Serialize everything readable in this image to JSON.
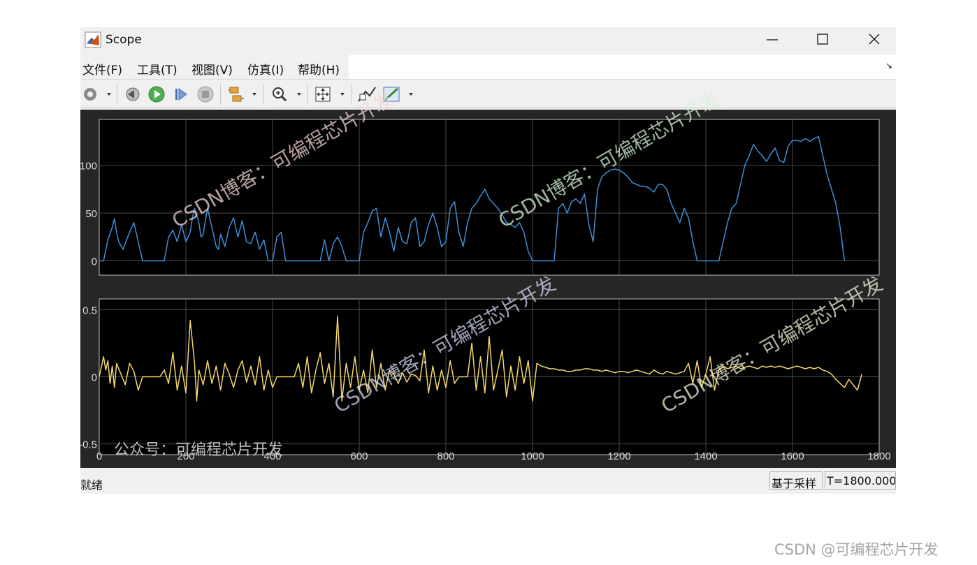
{
  "window": {
    "title": "Scope"
  },
  "menu": [
    "文件(F)",
    "工具(T)",
    "视图(V)",
    "仿真(I)",
    "帮助(H)"
  ],
  "toolbar": {
    "buttons": [
      "gear-icon",
      "step-back-icon",
      "run-icon",
      "step-forward-icon",
      "stop-icon",
      "signal-select-icon",
      "zoom-icon",
      "autoscale-icon",
      "data-cursor-icon",
      "measure-icon"
    ]
  },
  "plots": [
    {
      "line_color": "#3f8fd6",
      "yticks": [
        0,
        50,
        100
      ],
      "ylim": [
        -15,
        148
      ]
    },
    {
      "line_color": "#f5d76b",
      "yticks": [
        -0.5,
        0,
        0.5
      ],
      "ylim": [
        -0.58,
        0.58
      ]
    }
  ],
  "xaxis": {
    "xlim": [
      0,
      1800
    ],
    "ticks": [
      0,
      200,
      400,
      600,
      800,
      1000,
      1200,
      1400,
      1600,
      1800
    ]
  },
  "chart_data": [
    {
      "type": "line",
      "x": [
        0,
        10,
        20,
        30,
        35,
        40,
        45,
        55,
        60,
        70,
        80,
        90,
        100,
        110,
        120,
        130,
        140,
        150,
        160,
        170,
        180,
        190,
        200,
        210,
        215,
        220,
        230,
        235,
        240,
        245,
        250,
        260,
        270,
        275,
        280,
        290,
        300,
        310,
        320,
        330,
        340,
        350,
        360,
        370,
        380,
        390,
        400,
        410,
        420,
        430,
        440,
        450,
        460,
        470,
        480,
        490,
        500,
        510,
        520,
        530,
        540,
        550,
        560,
        570,
        580,
        590,
        600,
        610,
        620,
        630,
        640,
        650,
        660,
        670,
        680,
        690,
        700,
        710,
        720,
        730,
        740,
        750,
        760,
        770,
        780,
        790,
        800,
        810,
        820,
        830,
        840,
        850,
        860,
        870,
        880,
        890,
        900,
        910,
        920,
        930,
        940,
        950,
        960,
        970,
        980,
        990,
        1000,
        1010,
        1020,
        1030,
        1040,
        1050,
        1060,
        1070,
        1080,
        1090,
        1100,
        1110,
        1120,
        1130,
        1140,
        1150,
        1160,
        1170,
        1180,
        1190,
        1200,
        1210,
        1220,
        1230,
        1240,
        1250,
        1260,
        1270,
        1280,
        1290,
        1300,
        1310,
        1320,
        1330,
        1340,
        1350,
        1360,
        1370,
        1380,
        1390,
        1400,
        1410,
        1420,
        1430,
        1440,
        1450,
        1460,
        1470,
        1480,
        1490,
        1500,
        1510,
        1520,
        1530,
        1540,
        1550,
        1560,
        1570,
        1580,
        1590,
        1600,
        1610,
        1620,
        1630,
        1640,
        1650,
        1660,
        1670,
        1680,
        1690,
        1700,
        1710,
        1720,
        1730,
        1740,
        1750,
        1760,
        1770,
        1780,
        1790,
        1800
      ],
      "y": [
        0,
        0,
        22,
        35,
        44,
        30,
        20,
        12,
        18,
        30,
        40,
        20,
        0,
        0,
        0,
        0,
        0,
        0,
        25,
        32,
        20,
        38,
        20,
        30,
        45,
        55,
        40,
        25,
        28,
        42,
        55,
        35,
        15,
        12,
        28,
        15,
        35,
        45,
        25,
        42,
        20,
        18,
        30,
        12,
        22,
        0,
        0,
        25,
        30,
        0,
        0,
        0,
        0,
        0,
        0,
        0,
        0,
        0,
        22,
        0,
        18,
        25,
        15,
        0,
        0,
        0,
        0,
        30,
        40,
        52,
        55,
        25,
        45,
        30,
        10,
        35,
        20,
        18,
        40,
        45,
        15,
        20,
        38,
        50,
        35,
        15,
        20,
        55,
        62,
        30,
        15,
        40,
        55,
        60,
        68,
        75,
        65,
        60,
        55,
        48,
        40,
        38,
        35,
        40,
        30,
        10,
        0,
        0,
        0,
        0,
        0,
        0,
        55,
        60,
        50,
        62,
        65,
        60,
        70,
        38,
        20,
        75,
        88,
        92,
        95,
        96,
        95,
        92,
        88,
        82,
        80,
        78,
        78,
        76,
        72,
        80,
        80,
        75,
        60,
        50,
        40,
        55,
        45,
        20,
        0,
        0,
        0,
        0,
        0,
        0,
        20,
        40,
        55,
        60,
        80,
        100,
        110,
        122,
        115,
        110,
        104,
        112,
        118,
        105,
        103,
        120,
        126,
        126,
        125,
        128,
        125,
        128,
        130,
        110,
        90,
        75,
        60,
        35,
        0
      ]
    },
    {
      "type": "line",
      "x": [
        0,
        10,
        15,
        20,
        25,
        30,
        35,
        40,
        50,
        60,
        70,
        80,
        90,
        100,
        110,
        120,
        130,
        140,
        150,
        160,
        170,
        180,
        190,
        200,
        210,
        220,
        225,
        230,
        240,
        250,
        260,
        270,
        280,
        290,
        300,
        310,
        320,
        330,
        340,
        350,
        360,
        370,
        380,
        390,
        400,
        410,
        420,
        430,
        440,
        450,
        460,
        470,
        480,
        490,
        500,
        510,
        520,
        530,
        540,
        550,
        560,
        570,
        580,
        590,
        600,
        610,
        620,
        630,
        640,
        650,
        660,
        670,
        680,
        690,
        700,
        710,
        720,
        730,
        740,
        750,
        760,
        770,
        780,
        790,
        800,
        810,
        820,
        830,
        840,
        850,
        860,
        870,
        880,
        890,
        900,
        910,
        920,
        930,
        940,
        950,
        960,
        970,
        980,
        990,
        1000,
        1010,
        1020,
        1030,
        1040,
        1050,
        1060,
        1070,
        1080,
        1090,
        1100,
        1110,
        1120,
        1130,
        1140,
        1150,
        1160,
        1170,
        1180,
        1190,
        1200,
        1210,
        1220,
        1230,
        1240,
        1250,
        1260,
        1270,
        1280,
        1290,
        1300,
        1310,
        1320,
        1330,
        1340,
        1350,
        1360,
        1370,
        1380,
        1390,
        1400,
        1410,
        1420,
        1430,
        1440,
        1450,
        1460,
        1470,
        1480,
        1490,
        1500,
        1510,
        1520,
        1530,
        1540,
        1550,
        1560,
        1570,
        1580,
        1590,
        1600,
        1610,
        1620,
        1630,
        1640,
        1650,
        1660,
        1670,
        1680,
        1690,
        1700,
        1710,
        1720,
        1730,
        1740,
        1750,
        1760,
        1770,
        1780,
        1790,
        1800
      ],
      "y": [
        0,
        0.15,
        0.05,
        0.12,
        -0.05,
        0.08,
        -0.08,
        0.1,
        0.02,
        -0.06,
        0.1,
        0.04,
        -0.1,
        0,
        0,
        0,
        0,
        0,
        0.05,
        -0.05,
        0.18,
        -0.1,
        0.08,
        -0.12,
        0.42,
        0.1,
        -0.18,
        0.05,
        -0.06,
        0.12,
        -0.05,
        0.08,
        -0.1,
        0.1,
        0.02,
        -0.08,
        0.05,
        0.12,
        -0.04,
        0.08,
        -0.06,
        0.15,
        -0.1,
        0.05,
        -0.08,
        0,
        0,
        0,
        0,
        0,
        0.1,
        -0.08,
        0.15,
        -0.12,
        0.05,
        0.18,
        -0.05,
        0.1,
        -0.15,
        0.45,
        -0.18,
        0.1,
        -0.08,
        0.15,
        -0.1,
        0.05,
        -0.12,
        0.2,
        -0.08,
        0.1,
        -0.1,
        0.05,
        0.02,
        -0.05,
        0.03,
        -0.04,
        0.02,
        0.01,
        -0.03,
        0.2,
        -0.12,
        0.08,
        -0.1,
        0.05,
        -0.08,
        0.12,
        -0.05,
        0,
        0,
        0,
        0.25,
        -0.1,
        0.15,
        -0.12,
        0.3,
        -0.1,
        0.05,
        0.2,
        -0.15,
        0.08,
        -0.1,
        0.15,
        -0.05,
        0.12,
        -0.18,
        0.1,
        0.08,
        0.07,
        0.06,
        0.06,
        0.05,
        0.05,
        0.04,
        0.04,
        0.05,
        0.05,
        0.06,
        0.06,
        0.05,
        0.05,
        0.04,
        0.05,
        0.04,
        0.03,
        0.04,
        0.04,
        0.03,
        0.04,
        0.05,
        0.04,
        0.03,
        0.02,
        0.05,
        0.03,
        0.02,
        0.04,
        0.03,
        0.02,
        0.03,
        0.04,
        0.1,
        -0.05,
        0.12,
        -0.08,
        0.02,
        0.15,
        -0.1,
        0.05,
        0.08,
        0.06,
        0.07,
        0.08,
        0.06,
        0.07,
        0.08,
        0.07,
        0.06,
        0.08,
        0.07,
        0.08,
        0.07,
        0.08,
        0.07,
        0.06,
        0.07,
        0.08,
        0.07,
        0.06,
        0.07,
        0.06,
        0.07,
        0.05,
        0.04,
        0.02,
        -0.02,
        -0.05,
        -0.08,
        -0.02,
        -0.06,
        -0.1,
        0.02
      ]
    }
  ],
  "status": {
    "text": "就绪",
    "mode": "基于采样",
    "time": "T=1800.000"
  },
  "watermarks": {
    "overlay": "CSDN博客：可编程芯片开发",
    "gzh": "公众号：可编程芯片开发",
    "page": "CSDN @可编程芯片开发",
    "colors": [
      "#e9c9c9",
      "#c9e6c9",
      "#c9cde9",
      "#e6e6c9"
    ]
  }
}
